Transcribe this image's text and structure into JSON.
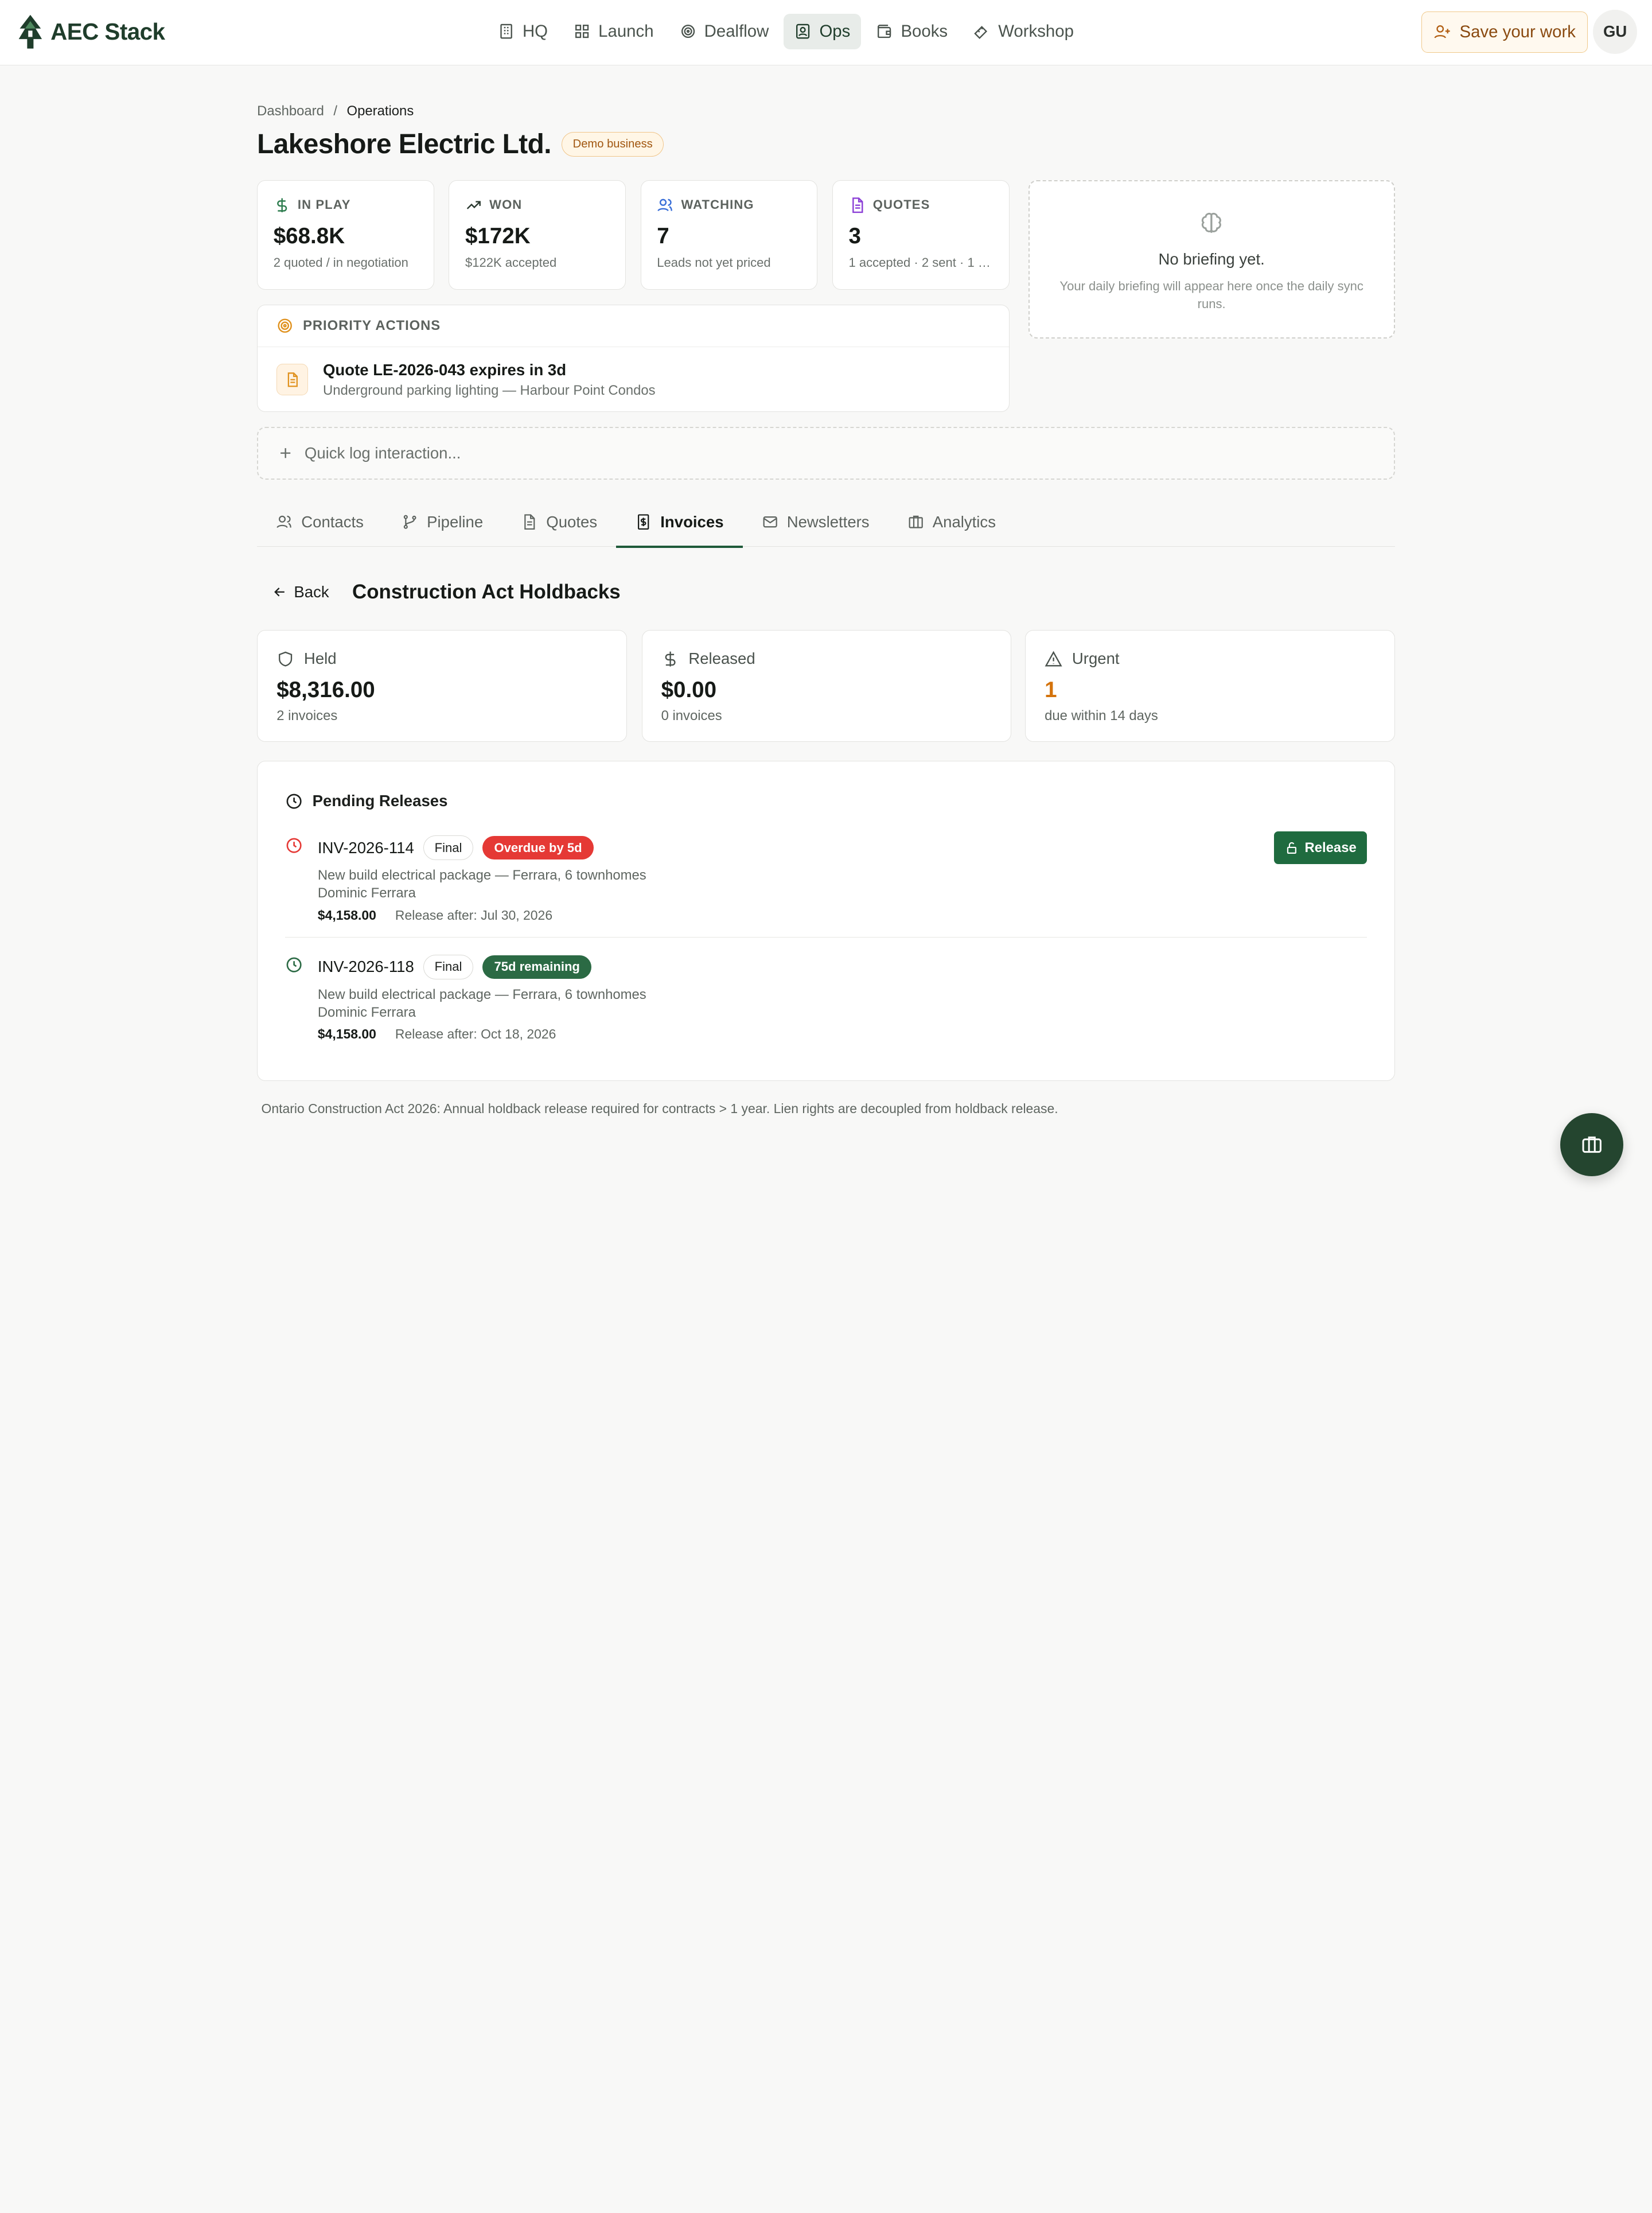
{
  "brand": {
    "name": "AEC Stack"
  },
  "nav": [
    {
      "label": "HQ",
      "icon": "building-icon"
    },
    {
      "label": "Launch",
      "icon": "grid-icon"
    },
    {
      "label": "Dealflow",
      "icon": "target-icon"
    },
    {
      "label": "Ops",
      "icon": "contact-icon",
      "active": true
    },
    {
      "label": "Books",
      "icon": "wallet-icon"
    },
    {
      "label": "Workshop",
      "icon": "ruler-icon"
    }
  ],
  "header": {
    "save_label": "Save your work",
    "avatar_initials": "GU"
  },
  "breadcrumb": {
    "root": "Dashboard",
    "sep": "/",
    "current": "Operations"
  },
  "page": {
    "title": "Lakeshore Electric Ltd.",
    "badge": "Demo business"
  },
  "stats": [
    {
      "label": "IN PLAY",
      "value": "$68.8K",
      "sub": "2 quoted / in negotiation",
      "color": "#2e7d4f"
    },
    {
      "label": "WON",
      "value": "$172K",
      "sub": "$122K accepted",
      "color": "#2b3a30"
    },
    {
      "label": "WATCHING",
      "value": "7",
      "sub": "Leads not yet priced",
      "color": "#3a6fd8"
    },
    {
      "label": "QUOTES",
      "value": "3",
      "sub": "1 accepted · 2 sent · 1 d...",
      "color": "#8b3fd6"
    }
  ],
  "briefing": {
    "title": "No briefing yet.",
    "sub": "Your daily briefing will appear here once the daily sync runs."
  },
  "priority": {
    "heading": "PRIORITY ACTIONS",
    "items": [
      {
        "title": "Quote LE-2026-043 expires in 3d",
        "sub": "Underground parking lighting — Harbour Point Condos"
      }
    ]
  },
  "quicklog": {
    "label": "Quick log interaction..."
  },
  "tabs": [
    {
      "label": "Contacts"
    },
    {
      "label": "Pipeline"
    },
    {
      "label": "Quotes"
    },
    {
      "label": "Invoices",
      "active": true
    },
    {
      "label": "Newsletters"
    },
    {
      "label": "Analytics"
    }
  ],
  "holdbacks": {
    "back_label": "Back",
    "title": "Construction Act Holdbacks",
    "cards": [
      {
        "label": "Held",
        "value": "$8,316.00",
        "sub": "2 invoices"
      },
      {
        "label": "Released",
        "value": "$0.00",
        "sub": "0 invoices"
      },
      {
        "label": "Urgent",
        "value": "1",
        "sub": "due within 14 days"
      }
    ],
    "pending_heading": "Pending Releases",
    "invoices": [
      {
        "id": "INV-2026-114",
        "type": "Final",
        "status": "Overdue by 5d",
        "desc": "New build electrical package — Ferrara, 6 townhomes",
        "contact": "Dominic Ferrara",
        "amount": "$4,158.00",
        "release_after": "Release after: Jul 30, 2026",
        "action": "Release"
      },
      {
        "id": "INV-2026-118",
        "type": "Final",
        "status": "75d remaining",
        "desc": "New build electrical package — Ferrara, 6 townhomes",
        "contact": "Dominic Ferrara",
        "amount": "$4,158.00",
        "release_after": "Release after: Oct 18, 2026"
      }
    ],
    "footnote": "Ontario Construction Act 2026: Annual holdback release required for contracts > 1 year. Lien rights are decoupled from holdback release."
  },
  "colors": {
    "accent": "#1f6b3f",
    "danger": "#e53935",
    "warning": "#d4730c"
  }
}
